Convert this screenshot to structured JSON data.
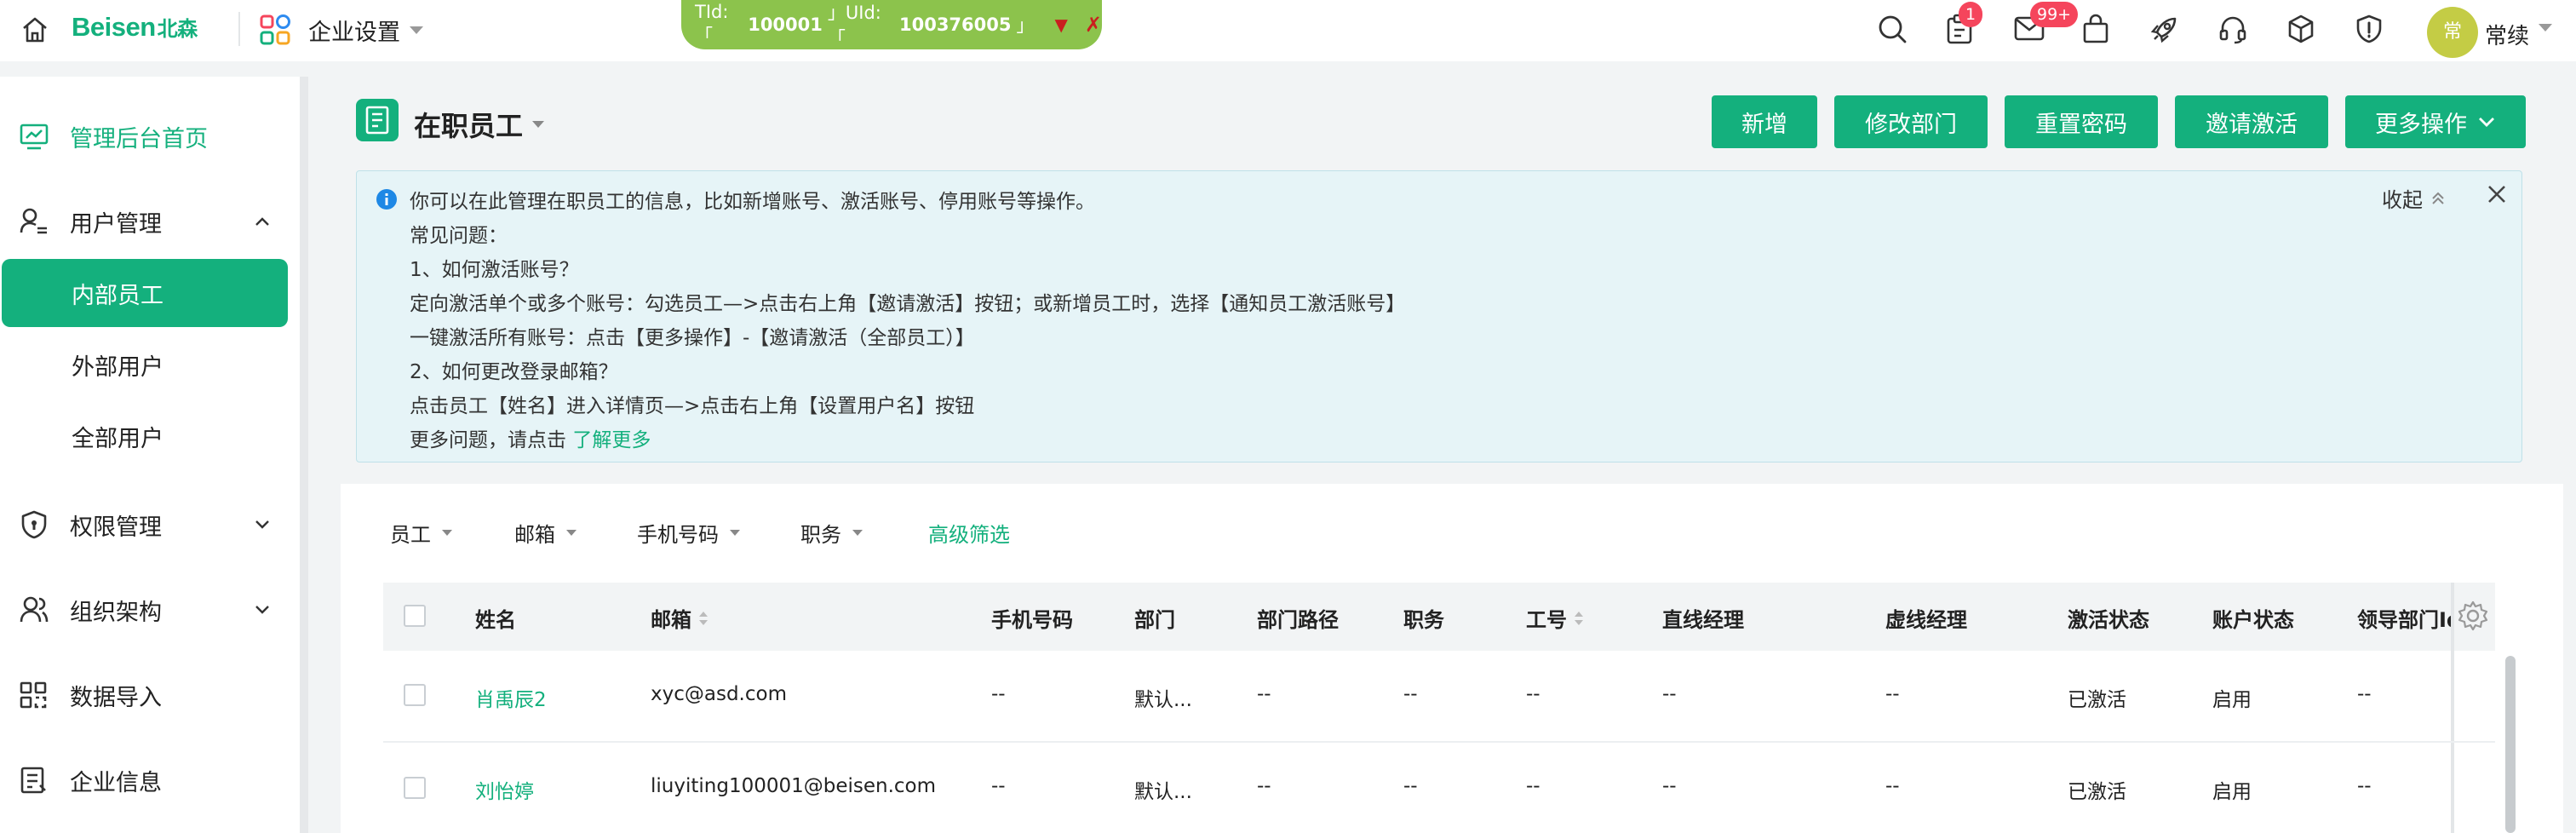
{
  "topbar": {
    "logo_text": "Beisen",
    "logo_cn": "北森",
    "company_setting": "企业设置",
    "tenant": {
      "tid_label": "TId:「",
      "tid_value": "100001",
      "uid_label": "」UId:「",
      "uid_value": "100376005",
      "uid_end": "」",
      "down": "▼",
      "close": "✗"
    },
    "badges": {
      "tasks": "1",
      "mail": "99+"
    },
    "avatar_text": "常",
    "username": "常续"
  },
  "sidebar": {
    "items": [
      {
        "label": "管理后台首页",
        "icon": "dashboard-icon"
      },
      {
        "label": "用户管理",
        "icon": "user-management-icon"
      },
      {
        "label": "内部员工"
      },
      {
        "label": "外部用户"
      },
      {
        "label": "全部用户"
      },
      {
        "label": "权限管理",
        "icon": "shield-icon"
      },
      {
        "label": "组织架构",
        "icon": "org-icon"
      },
      {
        "label": "数据导入",
        "icon": "data-import-icon"
      },
      {
        "label": "企业信息",
        "icon": "company-info-icon"
      }
    ]
  },
  "main": {
    "title": "在职员工",
    "buttons": {
      "add": "新增",
      "edit_dept": "修改部门",
      "reset_pwd": "重置密码",
      "invite": "邀请激活",
      "more": "更多操作"
    },
    "notice": {
      "line1": "你可以在此管理在职员工的信息，比如新增账号、激活账号、停用账号等操作。",
      "line2": "常见问题：",
      "line3": "1、如何激活账号？",
      "line4": "定向激活单个或多个账号：勾选员工—>点击右上角【邀请激活】按钮；或新增员工时，选择【通知员工激活账号】",
      "line5": "一键激活所有账号：点击【更多操作】-【邀请激活（全部员工）】",
      "line6": "2、如何更改登录邮箱？",
      "line7": "点击员工【姓名】进入详情页—>点击右上角【设置用户名】按钮",
      "line8": "更多问题，请点击",
      "learn_more": "了解更多",
      "collapse": "收起"
    },
    "filters": {
      "employee": "员工",
      "email": "邮箱",
      "phone": "手机号码",
      "position": "职务",
      "advanced": "高级筛选"
    },
    "table": {
      "headers": {
        "name": "姓名",
        "email": "邮箱",
        "phone": "手机号码",
        "dept": "部门",
        "dept_path": "部门路径",
        "position": "职务",
        "emp_no": "工号",
        "direct_mgr": "直线经理",
        "virtual_mgr": "虚线经理",
        "activation": "激活状态",
        "account": "账户状态",
        "leader_dept": "领导部门Id"
      },
      "rows": [
        {
          "name": "肖禹辰2",
          "email": "xyc@asd.com",
          "phone": "--",
          "dept": "默认...",
          "dept_path": "--",
          "position": "--",
          "emp_no": "--",
          "direct_mgr": "--",
          "virtual_mgr": "--",
          "activation": "已激活",
          "account": "启用",
          "leader_dept": "--"
        },
        {
          "name": "刘怡婷",
          "email": "liuyiting100001@beisen.com",
          "phone": "--",
          "dept": "默认...",
          "dept_path": "--",
          "position": "--",
          "emp_no": "--",
          "direct_mgr": "--",
          "virtual_mgr": "--",
          "activation": "已激活",
          "account": "启用",
          "leader_dept": "--"
        }
      ]
    }
  }
}
